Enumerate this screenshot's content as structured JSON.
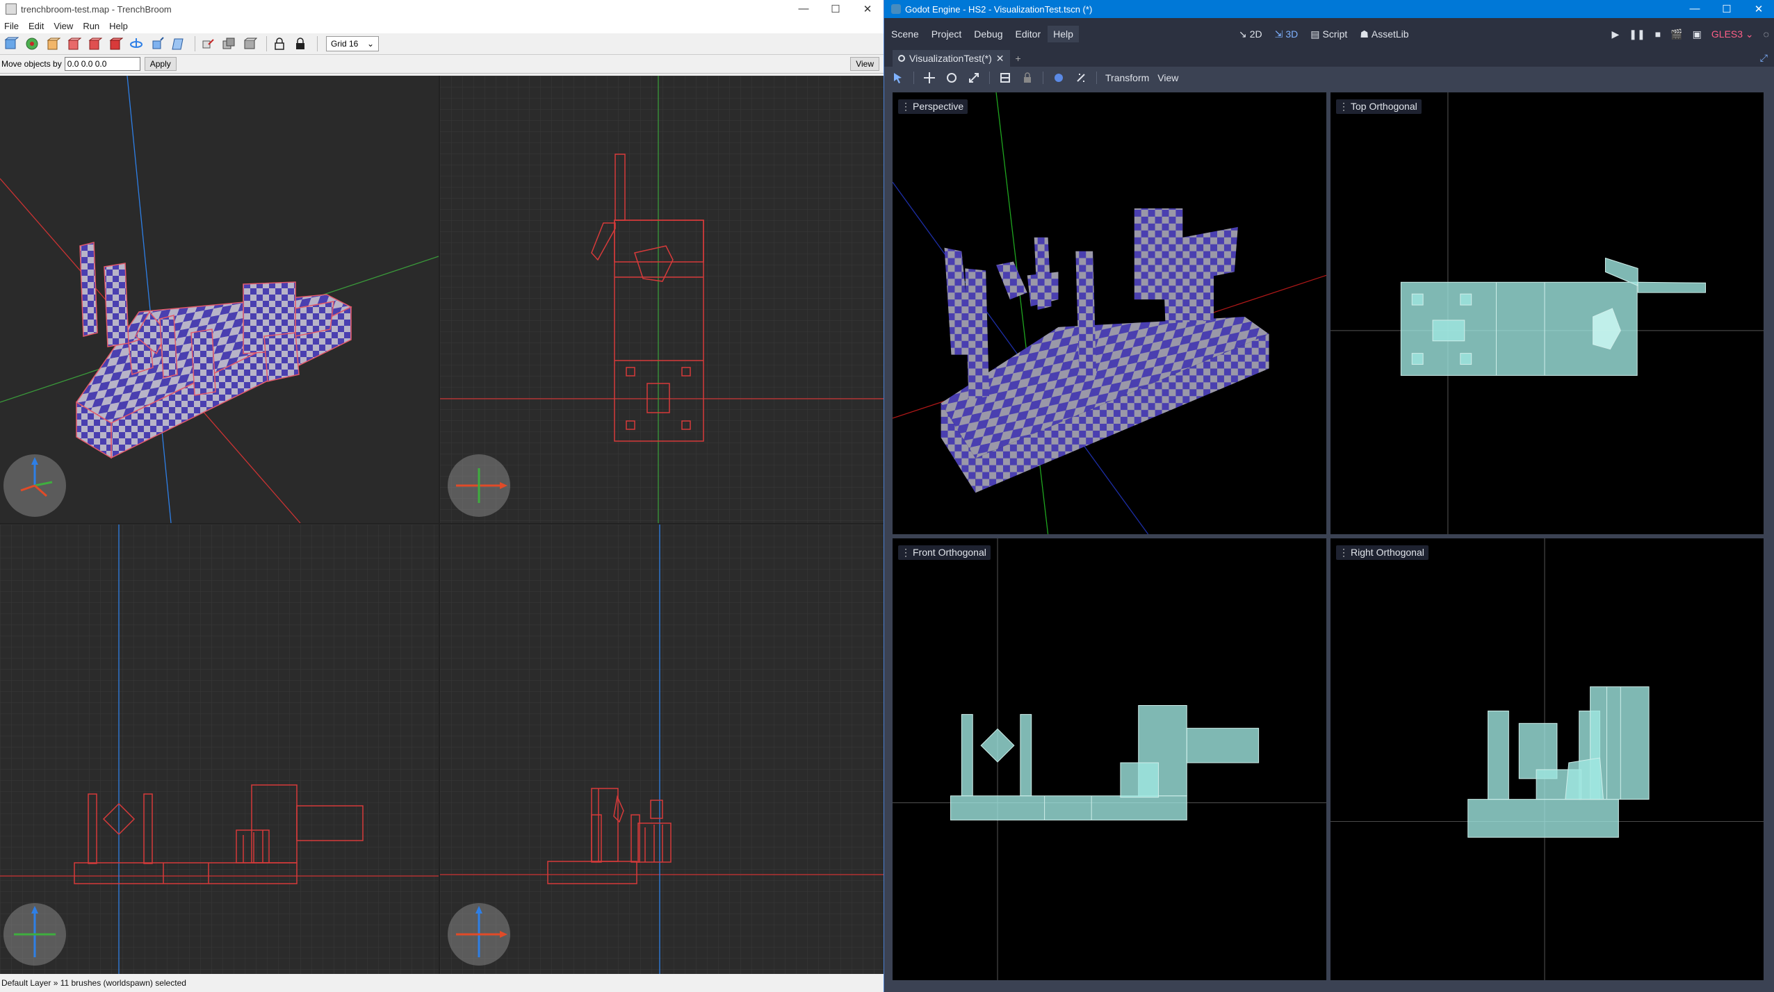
{
  "trenchbroom": {
    "title": "trenchbroom-test.map - TrenchBroom",
    "menu": [
      "File",
      "Edit",
      "View",
      "Run",
      "Help"
    ],
    "grid_select": "Grid 16",
    "move_label": "Move objects by",
    "move_value": "0.0 0.0 0.0",
    "apply_label": "Apply",
    "view_label": "View",
    "status": "Default Layer » 11 brushes (worldspawn) selected"
  },
  "godot": {
    "title": "Godot Engine - HS2 - VisualizationTest.tscn (*)",
    "menu": [
      "Scene",
      "Project",
      "Debug",
      "Editor",
      "Help"
    ],
    "modes": [
      "2D",
      "3D",
      "Script",
      "AssetLib"
    ],
    "renderer": "GLES3",
    "tab_label": "VisualizationTest(*)",
    "toolbar_menus": [
      "Transform",
      "View"
    ],
    "viewports": [
      "Perspective",
      "Top Orthogonal",
      "Front Orthogonal",
      "Right Orthogonal"
    ]
  },
  "window_buttons": {
    "minimize": "—",
    "maximize": "☐",
    "close": "✕"
  },
  "colors": {
    "wire_red": "#d63a3a",
    "checker_purple": "#4a3fb0",
    "checker_grey": "#b8b4c8",
    "gizmo_blue": "#2e7fe6",
    "gizmo_green": "#3fae3f",
    "gizmo_red": "#e14b28",
    "godot_teal": "#9fe6e0"
  }
}
